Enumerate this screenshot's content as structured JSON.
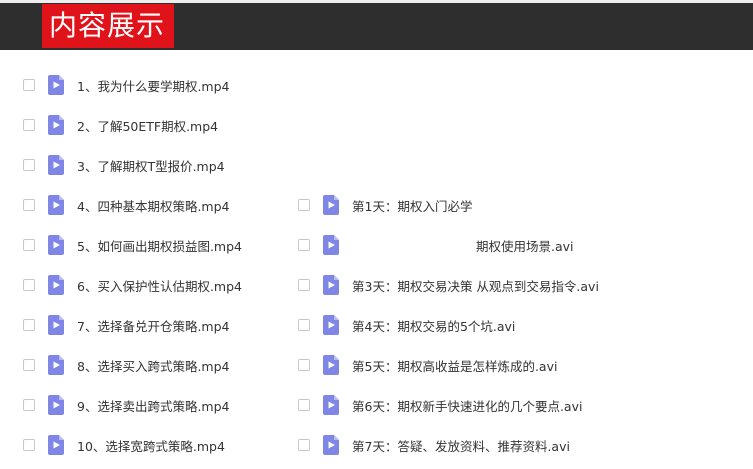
{
  "header": {
    "title": "内容展示"
  },
  "colors": {
    "header_bg": "#2e2e2e",
    "title_bg": "#e0131b",
    "icon": "#7f86e6"
  },
  "left_files": [
    "1、我为什么要学期权.mp4",
    "2、了解50ETF期权.mp4",
    "3、了解期权T型报价.mp4",
    "4、四种基本期权策略.mp4",
    "5、如何画出期权损益图.mp4",
    "6、买入保护性认估期权.mp4",
    "7、选择备兑开仓策略.mp4",
    "8、选择买入跨式策略.mp4",
    "9、选择卖出跨式策略.mp4",
    "10、选择宽跨式策略.mp4"
  ],
  "right_files": [
    "第1天：期权入门必学",
    "期权使用场景.avi",
    "第3天：期权交易决策 从观点到交易指令.avi",
    "第4天：期权交易的5个坑.avi",
    "第5天：期权高收益是怎样炼成的.avi",
    "第6天：期权新手快速进化的几个要点.avi",
    "第7天：答疑、发放资料、推荐资料.avi"
  ]
}
